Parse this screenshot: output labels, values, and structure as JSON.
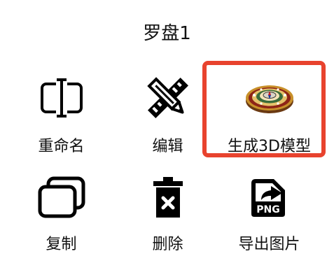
{
  "dialog": {
    "title": "罗盘1"
  },
  "actions": [
    {
      "id": "rename",
      "label": "重命名",
      "icon": "rename-icon"
    },
    {
      "id": "edit",
      "label": "编辑",
      "icon": "pencil-ruler-icon"
    },
    {
      "id": "generate3d",
      "label": "生成3D模型",
      "icon": "compass-3d-icon",
      "highlighted": true
    },
    {
      "id": "copy",
      "label": "复制",
      "icon": "copy-icon"
    },
    {
      "id": "delete",
      "label": "删除",
      "icon": "trash-icon"
    },
    {
      "id": "export",
      "label": "导出图片",
      "icon": "png-export-icon"
    }
  ],
  "colors": {
    "highlight_border": "#e8432e",
    "icon": "#000000"
  }
}
